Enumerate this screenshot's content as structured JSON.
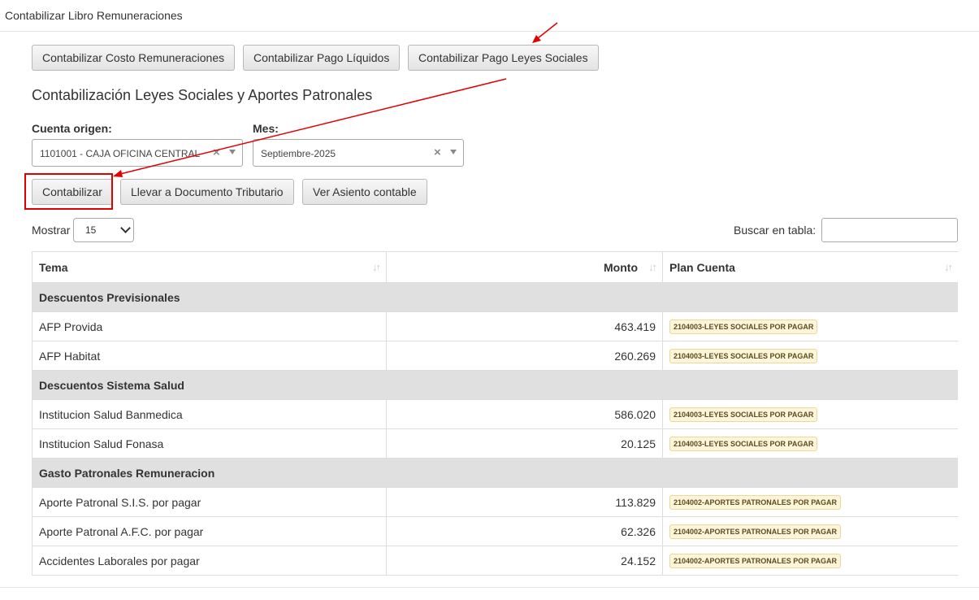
{
  "header": {
    "title": "Contabilizar Libro Remuneraciones"
  },
  "top_buttons": {
    "costo": "Contabilizar Costo Remuneraciones",
    "liquidos": "Contabilizar Pago Líquidos",
    "leyes": "Contabilizar Pago Leyes Sociales"
  },
  "section_title": "Contabilización Leyes Sociales y Aportes Patronales",
  "form": {
    "cuenta_label": "Cuenta origen:",
    "cuenta_value": "1101001 - CAJA OFICINA CENTRAL",
    "mes_label": "Mes:",
    "mes_value": "Septiembre-2025",
    "clear_glyph": "×"
  },
  "action_buttons": {
    "contabilizar": "Contabilizar",
    "llevar": "Llevar a Documento Tributario",
    "ver": "Ver Asiento contable"
  },
  "table_controls": {
    "mostrar_label": "Mostrar",
    "length_value": "15",
    "search_label": "Buscar en tabla:"
  },
  "table": {
    "headers": [
      "Tema",
      "Monto",
      "Plan Cuenta"
    ],
    "sort_glyph": "↓↑",
    "rows": [
      {
        "group": "Descuentos Previsionales"
      },
      {
        "tema": "AFP Provida",
        "monto": "463.419",
        "cuenta": "2104003-LEYES SOCIALES POR PAGAR"
      },
      {
        "tema": "AFP Habitat",
        "monto": "260.269",
        "cuenta": "2104003-LEYES SOCIALES POR PAGAR"
      },
      {
        "group": "Descuentos Sistema Salud"
      },
      {
        "tema": "Institucion Salud Banmedica",
        "monto": "586.020",
        "cuenta": "2104003-LEYES SOCIALES POR PAGAR"
      },
      {
        "tema": "Institucion Salud Fonasa",
        "monto": "20.125",
        "cuenta": "2104003-LEYES SOCIALES POR PAGAR"
      },
      {
        "group": "Gasto Patronales Remuneracion"
      },
      {
        "tema": "Aporte Patronal S.I.S. por pagar",
        "monto": "113.829",
        "cuenta": "2104002-APORTES PATRONALES POR PAGAR"
      },
      {
        "tema": "Aporte Patronal A.F.C. por pagar",
        "monto": "62.326",
        "cuenta": "2104002-APORTES PATRONALES POR PAGAR"
      },
      {
        "tema": "Accidentes Laborales por pagar",
        "monto": "24.152",
        "cuenta": "2104002-APORTES PATRONALES POR PAGAR"
      }
    ]
  },
  "colors": {
    "annotation_red": "#e00000",
    "group_row_bg": "#e0e0e0",
    "badge_bg": "#fcf5d9"
  }
}
